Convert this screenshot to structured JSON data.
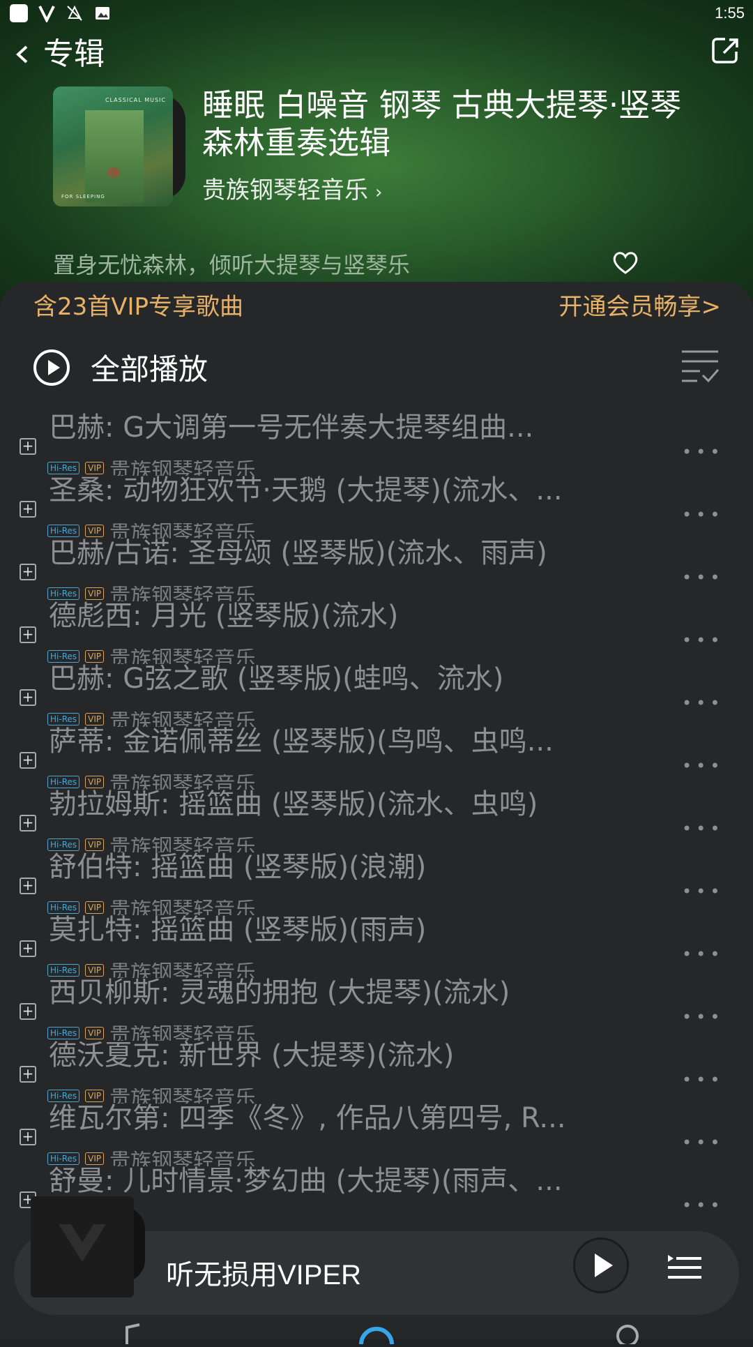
{
  "status": {
    "time": "1:55"
  },
  "header": {
    "title": "专辑"
  },
  "album": {
    "cover_text_top": "CLASSICAL MUSIC",
    "cover_text_bottom": "FOR SLEEPING",
    "title": "睡眠 白噪音 钢琴 古典大提琴·竖琴森林重奏选辑",
    "artist": "贵族钢琴轻音乐",
    "description": "置身无忧森林，倾听大提琴与竖琴乐"
  },
  "vip": {
    "left": "含23首VIP专享歌曲",
    "right": "开通会员畅享>"
  },
  "play_all": {
    "label": "全部播放"
  },
  "badges": {
    "hires": "Hi-Res",
    "vip": "VIP"
  },
  "songs": [
    {
      "name": "巴赫: G大调第一号无伴奏大提琴组曲...",
      "artist": "贵族钢琴轻音乐"
    },
    {
      "name": "圣桑: 动物狂欢节·天鹅 (大提琴)(流水、...",
      "artist": "贵族钢琴轻音乐"
    },
    {
      "name": "巴赫/古诺: 圣母颂 (竖琴版)(流水、雨声)",
      "artist": "贵族钢琴轻音乐"
    },
    {
      "name": "德彪西: 月光 (竖琴版)(流水)",
      "artist": "贵族钢琴轻音乐"
    },
    {
      "name": "巴赫: G弦之歌 (竖琴版)(蛙鸣、流水)",
      "artist": "贵族钢琴轻音乐"
    },
    {
      "name": "萨蒂: 金诺佩蒂丝 (竖琴版)(鸟鸣、虫鸣...",
      "artist": "贵族钢琴轻音乐"
    },
    {
      "name": "勃拉姆斯: 摇篮曲 (竖琴版)(流水、虫鸣)",
      "artist": "贵族钢琴轻音乐"
    },
    {
      "name": "舒伯特: 摇篮曲 (竖琴版)(浪潮)",
      "artist": "贵族钢琴轻音乐"
    },
    {
      "name": "莫扎特: 摇篮曲 (竖琴版)(雨声)",
      "artist": "贵族钢琴轻音乐"
    },
    {
      "name": "西贝柳斯: 灵魂的拥抱 (大提琴)(流水)",
      "artist": "贵族钢琴轻音乐"
    },
    {
      "name": "德沃夏克: 新世界 (大提琴)(流水)",
      "artist": "贵族钢琴轻音乐"
    },
    {
      "name": "维瓦尔第: 四季《冬》, 作品八第四号, R...",
      "artist": "贵族钢琴轻音乐"
    },
    {
      "name": "舒曼: 儿时情景·梦幻曲 (大提琴)(雨声、...",
      "artist": ""
    }
  ],
  "player": {
    "title": "听无损用VIPER"
  },
  "colors": {
    "accent_vip": "#e7b168",
    "hires": "#4aa8d8",
    "sheet_bg": "#252729"
  }
}
